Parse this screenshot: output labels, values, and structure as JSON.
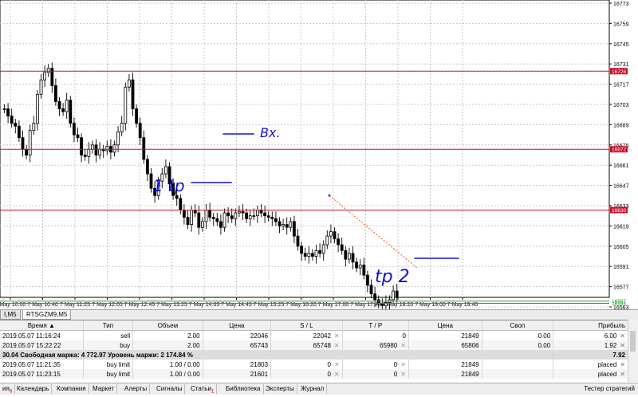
{
  "chart": {
    "price_ticks": [
      "16773",
      "16759",
      "16745",
      "16731",
      "16717",
      "16703",
      "16689",
      "16675",
      "16661",
      "16647",
      "16633",
      "16619",
      "16605",
      "16591",
      "16577",
      "16563",
      "16549",
      "16535"
    ],
    "time_ticks": [
      "7 May 10:00",
      "7 May 10:40",
      "7 May 11:25",
      "7 May 12:05",
      "7 May 12:45",
      "7 May 13:25",
      "7 May 14:05",
      "7 May 14:45",
      "7 May 15:25",
      "7 May 16:20",
      "7 May 17:00",
      "7 May 17:40",
      "7 May 18:20",
      "7 May 19:00",
      "7 May 19:40"
    ],
    "level_labels": [
      "16726",
      "16672",
      "16630",
      "16555"
    ],
    "green_labels": [
      "16567",
      "16566"
    ],
    "annotations": [
      "Вх.",
      "1 tp",
      "tp 2"
    ],
    "colors": {
      "level_line": "#c8102e",
      "green_line": "#22a52a",
      "ink": "#1010d0",
      "candle": "#000000",
      "trade_line": "#e05a1a"
    }
  },
  "chart_tab": {
    "left_label": "I,M5",
    "active_label": "RTSGZM9,M5"
  },
  "table": {
    "headers": [
      "Время",
      "Тип",
      "Объем",
      "Цена",
      "S / L",
      "T / P",
      "Цена",
      "Своп",
      "Прибыль"
    ],
    "rows": [
      {
        "time": "2019.05.07 11:16:24",
        "type": "sell",
        "volume": "2.00",
        "price": "22046",
        "sl": "22042",
        "tp": "0",
        "current": "21849",
        "swap": "0.00",
        "profit": "6.00"
      },
      {
        "time": "2019.05.07 15:22:22",
        "type": "buy",
        "volume": "2.00",
        "price": "65743",
        "sl": "65748",
        "tp": "65980",
        "current": "65806",
        "swap": "0.00",
        "profit": "1.92"
      }
    ],
    "summary": {
      "label": "30.04  Свободная маржа: 4 772.97  Уровень маржи: 2 174.84 %",
      "profit": "7.92"
    },
    "orders": [
      {
        "time": "2019.05.07 11:21:35",
        "type": "buy limit",
        "volume": "1.00 / 0.00",
        "price": "21803",
        "sl": "0",
        "tp": "0",
        "current": "21849",
        "swap": "",
        "profit": "placed"
      },
      {
        "time": "2019.05.07 11:23:15",
        "type": "buy limit",
        "volume": "1.00 / 0.00",
        "price": "21601",
        "sl": "0",
        "tp": "0",
        "current": "21849",
        "swap": "",
        "profit": "placed"
      }
    ]
  },
  "bottom_tabs": [
    "ия",
    "Календарь",
    "Компания",
    "Маркет",
    "Алерты",
    "Сигналы",
    "Статьи",
    "Библиотека",
    "Эксперты",
    "Журнал"
  ],
  "tester_label": "Тестер стратегий"
}
